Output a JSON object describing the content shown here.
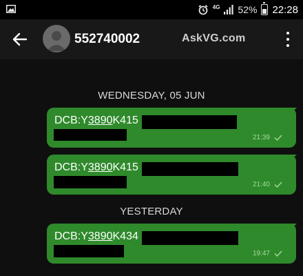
{
  "status_bar": {
    "network": "4G",
    "battery": "52%",
    "time": "22:28",
    "icons": [
      "image-notification-icon",
      "alarm-icon",
      "signal-icon",
      "battery-icon"
    ]
  },
  "header": {
    "contact": "552740002",
    "watermark": "AskVG.com",
    "icons": [
      "back-arrow-icon",
      "avatar",
      "more-options-icon"
    ]
  },
  "chat": {
    "groups": [
      {
        "date": "WEDNESDAY, 05 JUN",
        "messages": [
          {
            "prefix": "DCB:Y",
            "code": "3890",
            "suffix": "K415",
            "time": "21:39"
          },
          {
            "prefix": "DCB:Y",
            "code": "3890",
            "suffix": "K415",
            "time": "21:40"
          }
        ]
      },
      {
        "date": "YESTERDAY",
        "messages": [
          {
            "prefix": "DCB:Y",
            "code": "3890",
            "suffix": "K434",
            "time": "19:47"
          }
        ]
      }
    ]
  },
  "colors": {
    "bubble": "#2f8a2b",
    "header": "#181818",
    "background": "#0f0f0f"
  }
}
